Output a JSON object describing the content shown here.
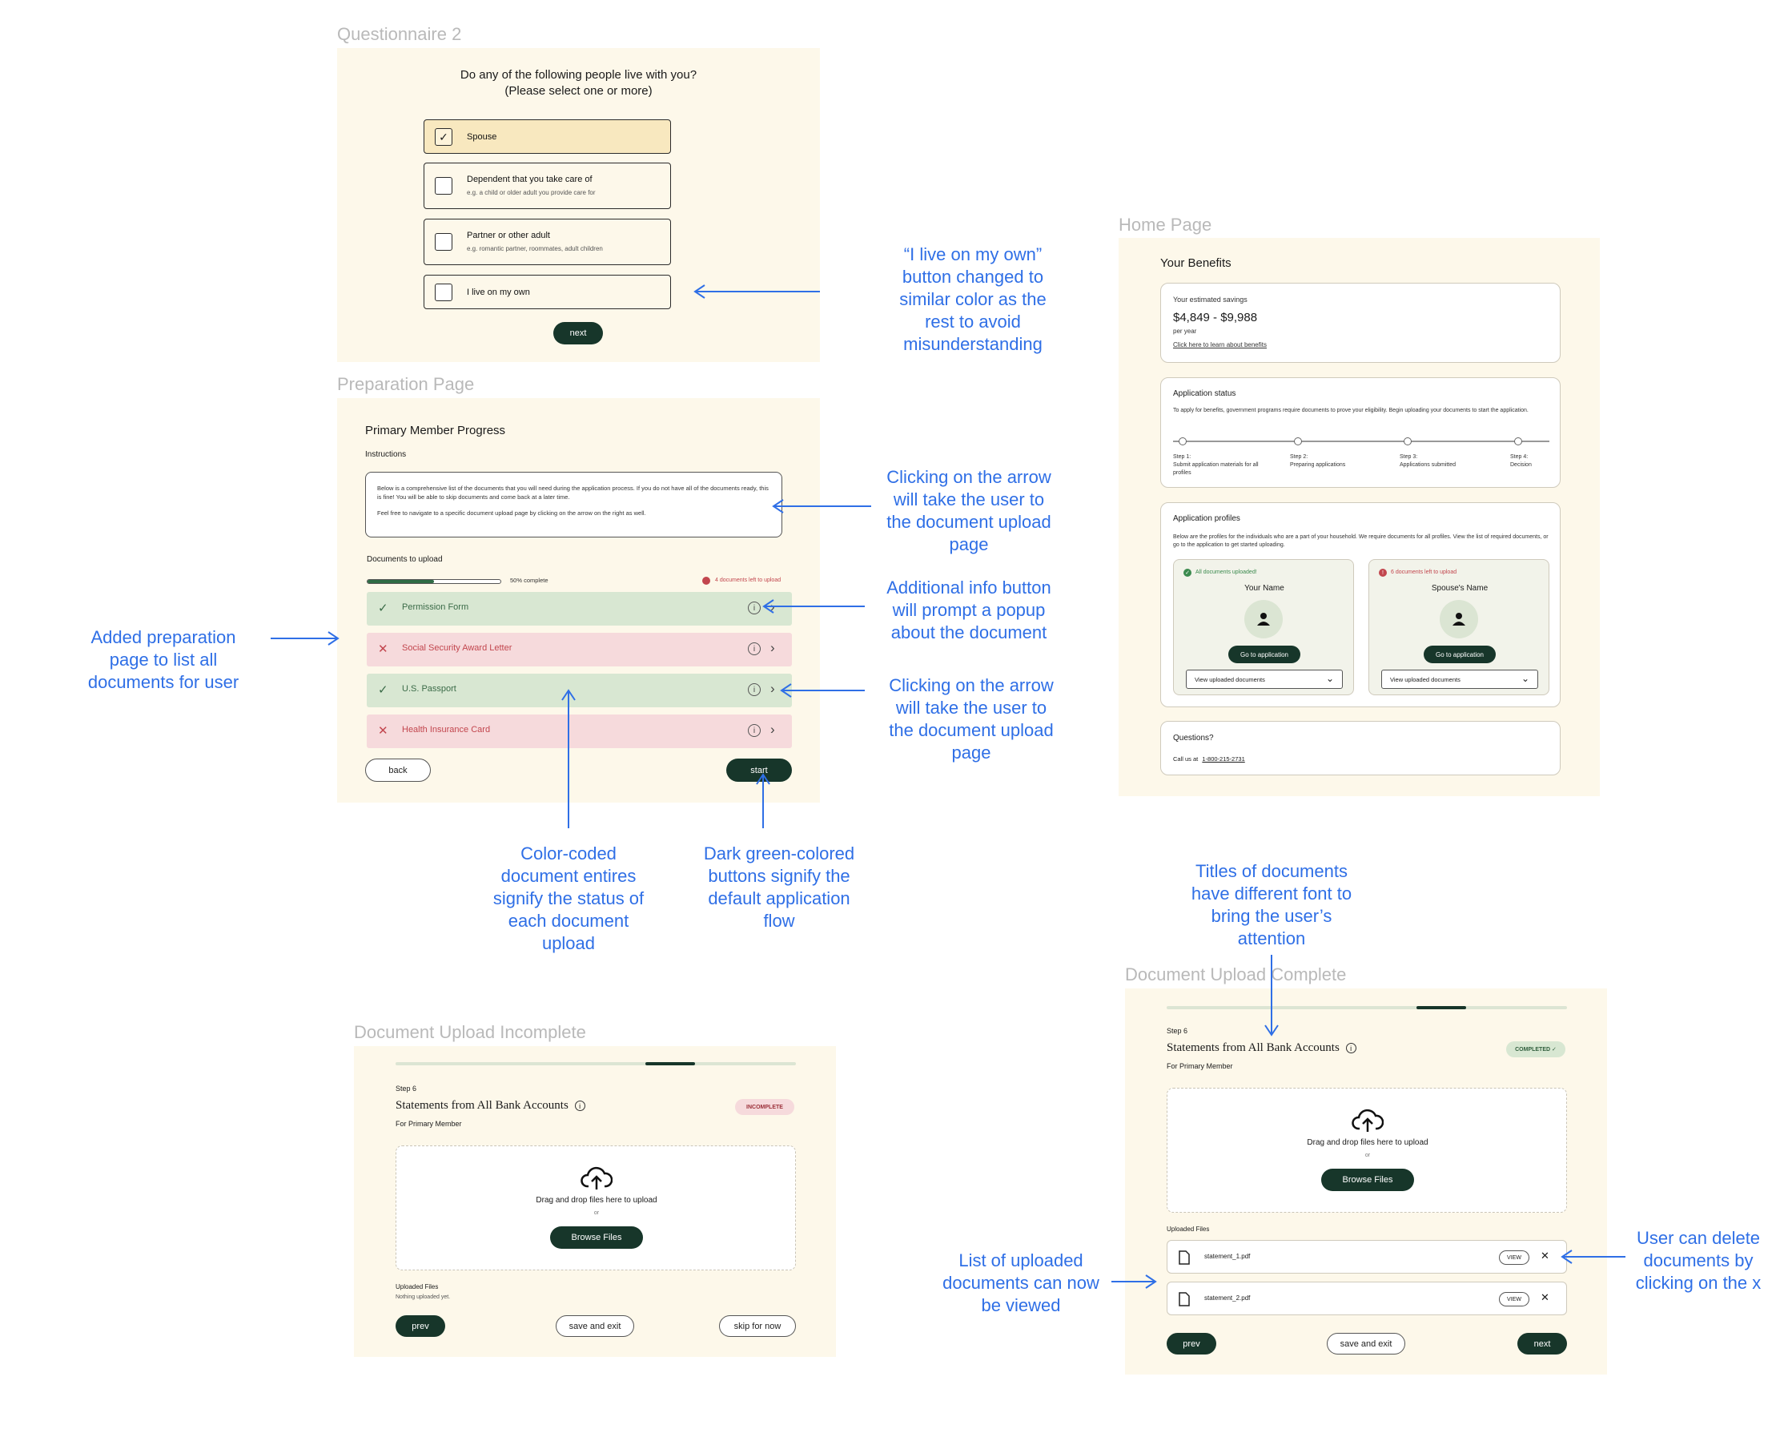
{
  "frames": {
    "questionnaire_title": "Questionnaire 2",
    "preparation_title": "Preparation Page",
    "home_title": "Home Page",
    "incomplete_title": "Document Upload Incomplete",
    "complete_title": "Document Upload Complete"
  },
  "questionnaire": {
    "question_line1": "Do any of the following people live with you?",
    "question_line2": "(Please select one or more)",
    "options": [
      {
        "label": "Spouse",
        "sub": "",
        "checked": true
      },
      {
        "label": "Dependent that you take care of",
        "sub": "e.g. a child or older adult you provide care for",
        "checked": false
      },
      {
        "label": "Partner or other adult",
        "sub": "e.g. romantic partner, roommates, adult children",
        "checked": false
      },
      {
        "label": "I live on my own",
        "sub": "",
        "checked": false
      }
    ],
    "next_label": "next"
  },
  "preparation": {
    "heading": "Primary Member Progress",
    "instructions_label": "Instructions",
    "instructions_p1": "Below is a comprehensive list of the documents that you will need during the application process. If you do not have all of the documents ready, this is fine! You will be able to skip documents and come back at a later time.",
    "instructions_p2": "Feel free to navigate to a specific document upload page by clicking on the arrow on the right as well.",
    "docs_label": "Documents to upload",
    "progress_text": "50% complete",
    "progress": 0.5,
    "docs_left": "4 documents left to upload",
    "documents": [
      {
        "name": "Permission Form",
        "status": "done"
      },
      {
        "name": "Social Security Award Letter",
        "status": "missing"
      },
      {
        "name": "U.S. Passport",
        "status": "done"
      },
      {
        "name": "Health Insurance Card",
        "status": "missing"
      }
    ],
    "back_label": "back",
    "start_label": "start"
  },
  "home": {
    "heading": "Your Benefits",
    "savings_label": "Your estimated savings",
    "savings_value": "$4,849 - $9,988",
    "savings_period": "per year",
    "savings_link": "Click here to learn about benefits",
    "status_label": "Application status",
    "status_desc": "To apply for benefits, government programs require documents to prove your eligibility. Begin uploading your documents to start the application.",
    "steps": [
      {
        "num": "Step 1:",
        "text": "Submit application materials for all profiles"
      },
      {
        "num": "Step 2:",
        "text": "Preparing applications"
      },
      {
        "num": "Step 3:",
        "text": "Applications submitted"
      },
      {
        "num": "Step 4:",
        "text": "Decision"
      }
    ],
    "profiles_label": "Application profiles",
    "profiles_desc": "Below are the profiles for the individuals who are a part of your household. We require documents for all profiles. View the list of required documents, or go to the application to get started uploading.",
    "profiles": [
      {
        "status": "All documents uploaded!",
        "name": "Your Name",
        "button": "Go to application",
        "dropdown": "View uploaded documents",
        "status_color": "#3b8a4e"
      },
      {
        "status": "6 documents left to upload",
        "name": "Spouse's Name",
        "button": "Go to application",
        "dropdown": "View uploaded documents",
        "status_color": "#c2464e"
      }
    ],
    "questions_label": "Questions?",
    "call_label": "Call us at",
    "phone": "1-800-215-2731"
  },
  "upload_incomplete": {
    "step": "Step 6",
    "title": "Statements from All Bank Accounts",
    "badge": "INCOMPLETE",
    "subtitle": "For Primary Member",
    "drop_text": "Drag and drop files here to upload",
    "or_text": "or",
    "browse_label": "Browse Files",
    "uploaded_label": "Uploaded Files",
    "empty_text": "Nothing uploaded yet.",
    "prev_label": "prev",
    "save_label": "save and exit",
    "skip_label": "skip for now"
  },
  "upload_complete": {
    "step": "Step 6",
    "title": "Statements from All Bank Accounts",
    "badge": "COMPLETED ✓",
    "subtitle": "For Primary Member",
    "drop_text": "Drag and drop files here to upload",
    "or_text": "or",
    "browse_label": "Browse Files",
    "uploaded_label": "Uploaded Files",
    "files": [
      {
        "name": "statement_1.pdf",
        "view": "VIEW"
      },
      {
        "name": "statement_2.pdf",
        "view": "VIEW"
      }
    ],
    "prev_label": "prev",
    "save_label": "save and exit",
    "next_label": "next"
  },
  "annotations": {
    "live_alone": [
      "“I live on my own”",
      "button changed to",
      "similar color as the",
      "rest to avoid",
      "misunderstanding"
    ],
    "arrow_instr": [
      "Clicking on the arrow",
      "will take the user to",
      "the document upload",
      "page"
    ],
    "info_button": [
      "Additional info button",
      "will prompt a popup",
      "about the document"
    ],
    "arrow_row": [
      "Clicking on the arrow",
      "will take the user to",
      "the document upload",
      "page"
    ],
    "added_prep": [
      "Added preparation",
      "page to list all",
      "documents for user"
    ],
    "color_coded": [
      "Color-coded",
      "document entires",
      "signify the status of",
      "each document",
      "upload"
    ],
    "dark_green": [
      "Dark green-colored",
      "buttons signify the",
      "default application",
      "flow"
    ],
    "titles_font": [
      "Titles of documents",
      "have different font to",
      "bring the user’s",
      "attention"
    ],
    "list_uploaded": [
      "List of uploaded",
      "documents can now",
      "be viewed"
    ],
    "delete": [
      "User can delete",
      "documents by",
      "clicking on the x"
    ]
  },
  "colors": {
    "frame_bg": "#fdf8ea",
    "dark_green": "#17362a",
    "annotation_blue": "#2f6fe6",
    "done_row": "#d8e7d2",
    "missing_row": "#f6dadc"
  }
}
